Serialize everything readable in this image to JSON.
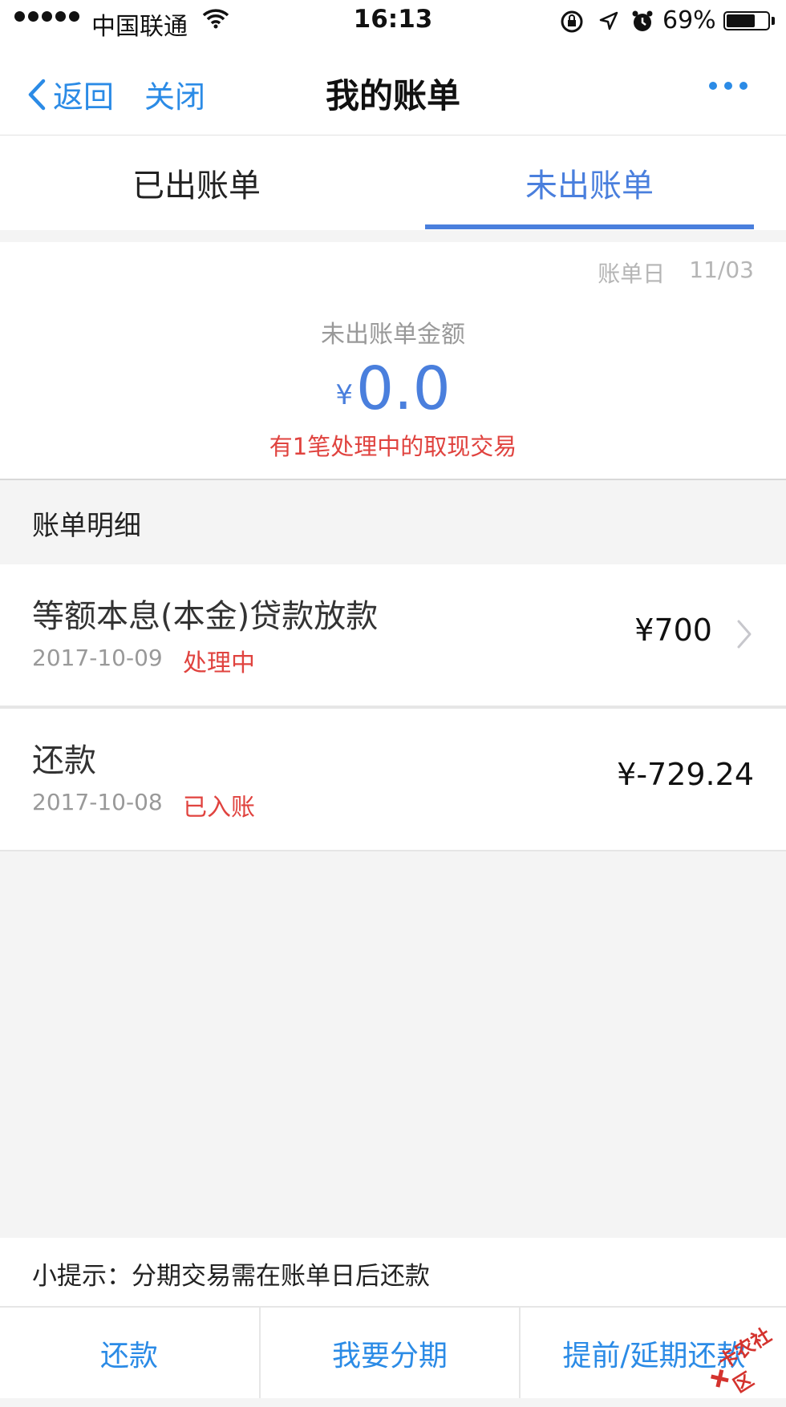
{
  "status_bar": {
    "carrier": "中国联通",
    "time": "16:13",
    "battery_percent": "69%",
    "battery_level": 0.69
  },
  "nav": {
    "back_label": "返回",
    "close_label": "关闭",
    "title": "我的账单"
  },
  "tabs": [
    {
      "label": "已出账单",
      "active": false
    },
    {
      "label": "未出账单",
      "active": true
    }
  ],
  "summary": {
    "bill_day_label": "账单日",
    "bill_day_value": "11/03",
    "amount_label": "未出账单金额",
    "currency": "¥",
    "amount": "0.0",
    "note": "有1笔处理中的取现交易"
  },
  "details": {
    "section_title": "账单明细",
    "rows": [
      {
        "title": "等额本息(本金)贷款放款",
        "date": "2017-10-09",
        "status": "处理中",
        "amount": "¥700",
        "has_chevron": true
      },
      {
        "title": "还款",
        "date": "2017-10-08",
        "status": "已入账",
        "amount": "¥-729.24",
        "has_chevron": false
      }
    ]
  },
  "tip": "小提示：分期交易需在账单日后还款",
  "buttons": [
    "还款",
    "我要分期",
    "提前/延期还款"
  ],
  "watermark": "卡农社区",
  "colors": {
    "accent_blue": "#2b8be6",
    "tab_blue": "#4a7fdd",
    "status_red": "#e0433f"
  }
}
